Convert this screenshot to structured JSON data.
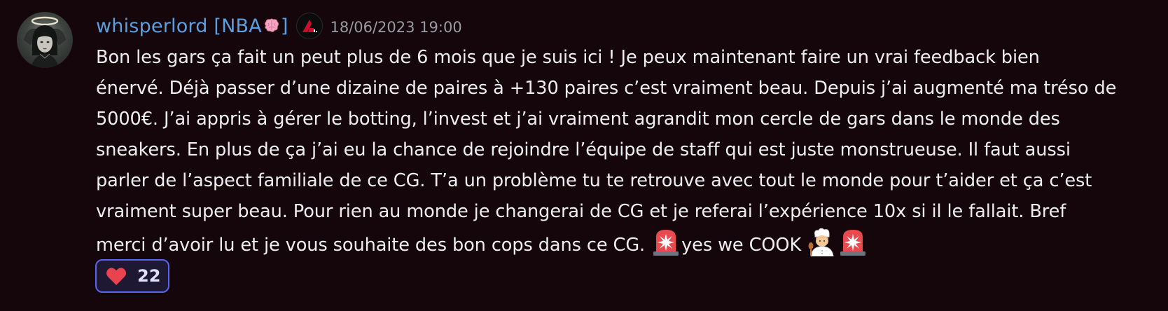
{
  "message": {
    "author": {
      "name_prefix": "whisperlord [NBA",
      "name_suffix": "]",
      "name_emoji": "brain-emoji",
      "role_icon": "role-badge-icon"
    },
    "timestamp": "18/06/2023 19:00",
    "lines": [
      "Bon les gars ça fait un peut plus de 6 mois que je suis ici ! Je peux maintenant faire un vrai feedback bien",
      "énervé. Déjà passer d’une dizaine de paires à +130 paires c’est vraiment beau. Depuis j’ai augmenté ma tréso de",
      "5000€. J’ai appris à gérer le botting, l’invest et j’ai vraiment agrandit mon cercle de gars dans le monde des",
      "sneakers. En plus de ça j’ai eu la chance de rejoindre l’équipe de staff qui est juste monstrueuse. Il faut aussi",
      "parler de l’aspect familiale de ce CG. T’a un problème tu te retrouve avec tout le monde pour t’aider et ça c’est",
      "vraiment super beau. Pour rien au monde je changerai de CG et je referai l’expérience 10x si il le fallait. Bref"
    ],
    "last_line": {
      "text_before": "merci d’avoir lu et je vous souhaite des bon cops dans ce CG. ",
      "text_after": "yes we COOK ",
      "emojis": [
        "rotating-light-emoji",
        "cook-emoji",
        "rotating-light-emoji"
      ]
    },
    "reaction": {
      "emoji": "heart-icon",
      "count": "22",
      "color": "#e8434f"
    }
  },
  "colors": {
    "background": "#14060b",
    "username": "#5a9fe0",
    "text": "#eeeef0",
    "timestamp": "#9a9ca3",
    "reaction_border": "#5865f2"
  }
}
